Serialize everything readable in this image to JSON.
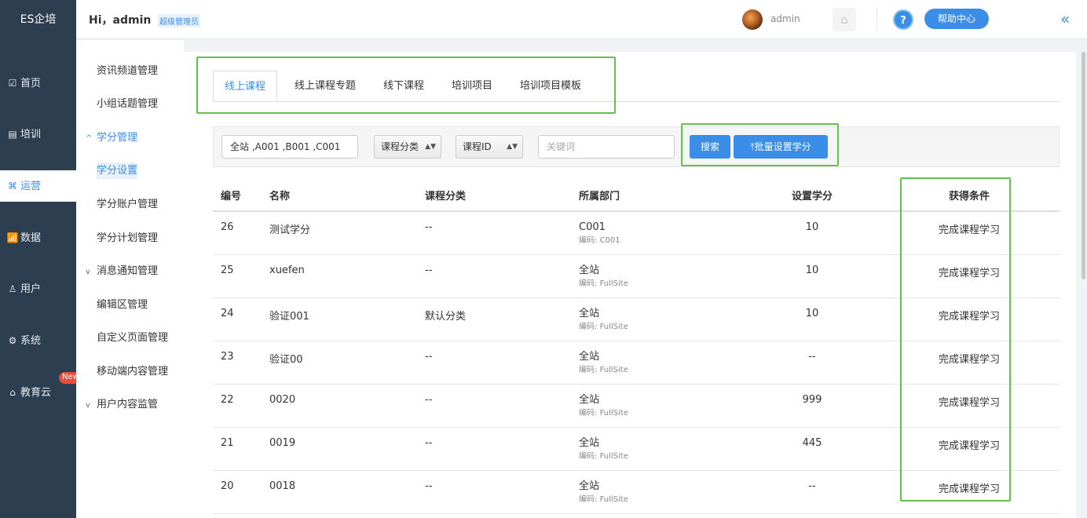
{
  "brand": "ES企培",
  "nav": [
    {
      "label": "首页",
      "icon": "dashboard-icon",
      "glyph": "☑"
    },
    {
      "label": "培训",
      "icon": "training-icon",
      "glyph": "▤"
    },
    {
      "label": "运营",
      "icon": "operations-icon",
      "glyph": "⌘"
    },
    {
      "label": "数据",
      "icon": "chart-icon",
      "glyph": "📶"
    },
    {
      "label": "用户",
      "icon": "user-icon",
      "glyph": "♙"
    },
    {
      "label": "系统",
      "icon": "gear-icon",
      "glyph": "⚙"
    },
    {
      "label": "教育云",
      "icon": "cloud-icon",
      "glyph": "⌂"
    }
  ],
  "nav_badge": "New",
  "header": {
    "greeting": "Hi，admin",
    "role": "超级管理员",
    "username": "admin",
    "help": "帮助中心",
    "help_q": "?",
    "home_glyph": "⌂",
    "collapse_glyph": "«"
  },
  "subnav": [
    "资讯频道管理",
    "小组话题管理",
    "学分管理",
    "学分设置",
    "学分账户管理",
    "学分计划管理",
    "消息通知管理",
    "编辑区管理",
    "自定义页面管理",
    "移动端内容管理",
    "用户内容监管"
  ],
  "subnav_chev_open": "^",
  "subnav_chev_closed": "v",
  "tabs": [
    "线上课程",
    "线上课程专题",
    "线下课程",
    "培训项目",
    "培训项目模板"
  ],
  "filter": {
    "org": "全站 ,A001 ,B001 ,C001",
    "category": "课程分类",
    "id_field": "课程ID",
    "keyword_placeholder": "关键词",
    "search": "搜索",
    "batch": "批量设置学分",
    "select_arrow": "▲▼"
  },
  "table": {
    "columns": [
      "编号",
      "名称",
      "课程分类",
      "所属部门",
      "设置学分",
      "获得条件"
    ],
    "code_prefix": "编码: ",
    "rows": [
      {
        "id": "26",
        "name": "测试学分",
        "category": "--",
        "dept": "C001",
        "code": "C001",
        "credit": "10",
        "cond": "完成课程学习"
      },
      {
        "id": "25",
        "name": "xuefen",
        "category": "--",
        "dept": "全站",
        "code": "FullSite",
        "credit": "10",
        "cond": "完成课程学习"
      },
      {
        "id": "24",
        "name": "验证001",
        "category": "默认分类",
        "dept": "全站",
        "code": "FullSite",
        "credit": "10",
        "cond": "完成课程学习"
      },
      {
        "id": "23",
        "name": "验证00",
        "category": "--",
        "dept": "全站",
        "code": "FullSite",
        "credit": "--",
        "cond": "完成课程学习"
      },
      {
        "id": "22",
        "name": "0020",
        "category": "--",
        "dept": "全站",
        "code": "FullSite",
        "credit": "999",
        "cond": "完成课程学习"
      },
      {
        "id": "21",
        "name": "0019",
        "category": "--",
        "dept": "全站",
        "code": "FullSite",
        "credit": "445",
        "cond": "完成课程学习"
      },
      {
        "id": "20",
        "name": "0018",
        "category": "--",
        "dept": "全站",
        "code": "FullSite",
        "credit": "--",
        "cond": "完成课程学习"
      }
    ]
  }
}
